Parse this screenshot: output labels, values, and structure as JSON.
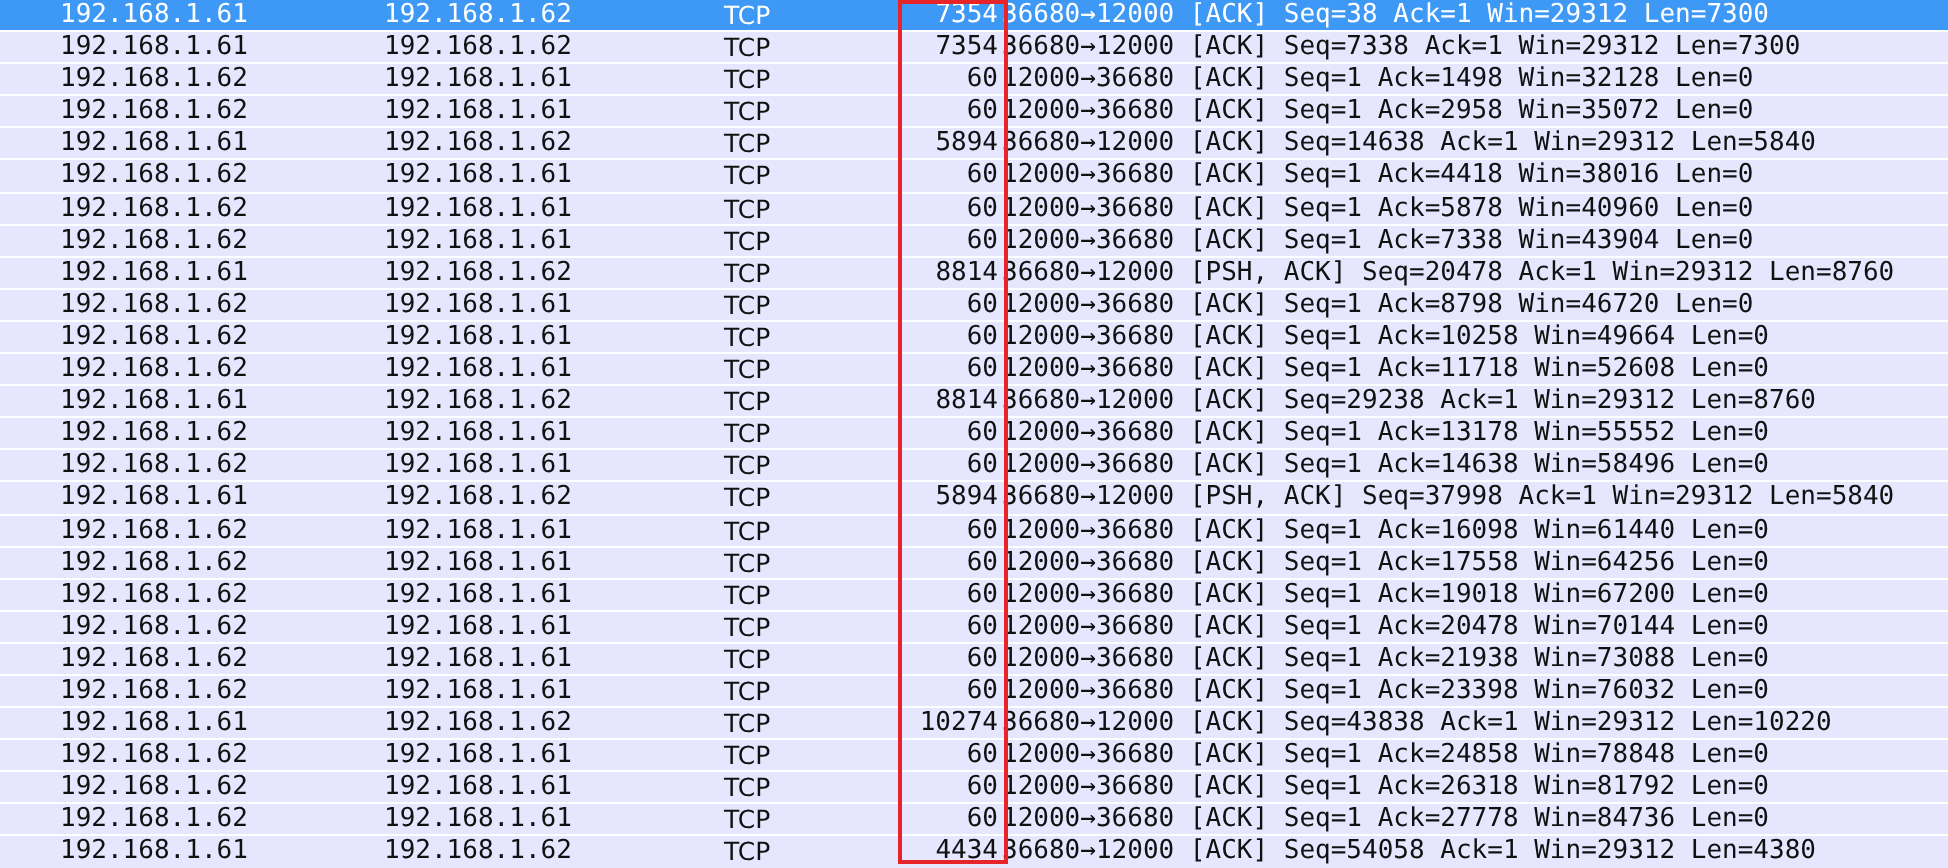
{
  "packets": [
    {
      "source": "192.168.1.61",
      "destination": "192.168.1.62",
      "protocol": "TCP",
      "length": "7354",
      "info": "36680→12000 [ACK] Seq=38 Ack=1 Win=29312 Len=7300",
      "selected": true
    },
    {
      "source": "192.168.1.61",
      "destination": "192.168.1.62",
      "protocol": "TCP",
      "length": "7354",
      "info": "36680→12000 [ACK] Seq=7338 Ack=1 Win=29312 Len=7300",
      "selected": false
    },
    {
      "source": "192.168.1.62",
      "destination": "192.168.1.61",
      "protocol": "TCP",
      "length": "60",
      "info": "12000→36680 [ACK] Seq=1 Ack=1498 Win=32128 Len=0",
      "selected": false
    },
    {
      "source": "192.168.1.62",
      "destination": "192.168.1.61",
      "protocol": "TCP",
      "length": "60",
      "info": "12000→36680 [ACK] Seq=1 Ack=2958 Win=35072 Len=0",
      "selected": false
    },
    {
      "source": "192.168.1.61",
      "destination": "192.168.1.62",
      "protocol": "TCP",
      "length": "5894",
      "info": "36680→12000 [ACK] Seq=14638 Ack=1 Win=29312 Len=5840",
      "selected": false
    },
    {
      "source": "192.168.1.62",
      "destination": "192.168.1.61",
      "protocol": "TCP",
      "length": "60",
      "info": "12000→36680 [ACK] Seq=1 Ack=4418 Win=38016 Len=0",
      "selected": false
    },
    {
      "source": "192.168.1.62",
      "destination": "192.168.1.61",
      "protocol": "TCP",
      "length": "60",
      "info": "12000→36680 [ACK] Seq=1 Ack=5878 Win=40960 Len=0",
      "selected": false
    },
    {
      "source": "192.168.1.62",
      "destination": "192.168.1.61",
      "protocol": "TCP",
      "length": "60",
      "info": "12000→36680 [ACK] Seq=1 Ack=7338 Win=43904 Len=0",
      "selected": false
    },
    {
      "source": "192.168.1.61",
      "destination": "192.168.1.62",
      "protocol": "TCP",
      "length": "8814",
      "info": "36680→12000 [PSH, ACK] Seq=20478 Ack=1 Win=29312 Len=8760",
      "selected": false
    },
    {
      "source": "192.168.1.62",
      "destination": "192.168.1.61",
      "protocol": "TCP",
      "length": "60",
      "info": "12000→36680 [ACK] Seq=1 Ack=8798 Win=46720 Len=0",
      "selected": false
    },
    {
      "source": "192.168.1.62",
      "destination": "192.168.1.61",
      "protocol": "TCP",
      "length": "60",
      "info": "12000→36680 [ACK] Seq=1 Ack=10258 Win=49664 Len=0",
      "selected": false
    },
    {
      "source": "192.168.1.62",
      "destination": "192.168.1.61",
      "protocol": "TCP",
      "length": "60",
      "info": "12000→36680 [ACK] Seq=1 Ack=11718 Win=52608 Len=0",
      "selected": false
    },
    {
      "source": "192.168.1.61",
      "destination": "192.168.1.62",
      "protocol": "TCP",
      "length": "8814",
      "info": "36680→12000 [ACK] Seq=29238 Ack=1 Win=29312 Len=8760",
      "selected": false
    },
    {
      "source": "192.168.1.62",
      "destination": "192.168.1.61",
      "protocol": "TCP",
      "length": "60",
      "info": "12000→36680 [ACK] Seq=1 Ack=13178 Win=55552 Len=0",
      "selected": false
    },
    {
      "source": "192.168.1.62",
      "destination": "192.168.1.61",
      "protocol": "TCP",
      "length": "60",
      "info": "12000→36680 [ACK] Seq=1 Ack=14638 Win=58496 Len=0",
      "selected": false
    },
    {
      "source": "192.168.1.61",
      "destination": "192.168.1.62",
      "protocol": "TCP",
      "length": "5894",
      "info": "36680→12000 [PSH, ACK] Seq=37998 Ack=1 Win=29312 Len=5840",
      "selected": false
    },
    {
      "source": "192.168.1.62",
      "destination": "192.168.1.61",
      "protocol": "TCP",
      "length": "60",
      "info": "12000→36680 [ACK] Seq=1 Ack=16098 Win=61440 Len=0",
      "selected": false
    },
    {
      "source": "192.168.1.62",
      "destination": "192.168.1.61",
      "protocol": "TCP",
      "length": "60",
      "info": "12000→36680 [ACK] Seq=1 Ack=17558 Win=64256 Len=0",
      "selected": false
    },
    {
      "source": "192.168.1.62",
      "destination": "192.168.1.61",
      "protocol": "TCP",
      "length": "60",
      "info": "12000→36680 [ACK] Seq=1 Ack=19018 Win=67200 Len=0",
      "selected": false
    },
    {
      "source": "192.168.1.62",
      "destination": "192.168.1.61",
      "protocol": "TCP",
      "length": "60",
      "info": "12000→36680 [ACK] Seq=1 Ack=20478 Win=70144 Len=0",
      "selected": false
    },
    {
      "source": "192.168.1.62",
      "destination": "192.168.1.61",
      "protocol": "TCP",
      "length": "60",
      "info": "12000→36680 [ACK] Seq=1 Ack=21938 Win=73088 Len=0",
      "selected": false
    },
    {
      "source": "192.168.1.62",
      "destination": "192.168.1.61",
      "protocol": "TCP",
      "length": "60",
      "info": "12000→36680 [ACK] Seq=1 Ack=23398 Win=76032 Len=0",
      "selected": false
    },
    {
      "source": "192.168.1.61",
      "destination": "192.168.1.62",
      "protocol": "TCP",
      "length": "10274",
      "info": "36680→12000 [ACK] Seq=43838 Ack=1 Win=29312 Len=10220",
      "selected": false
    },
    {
      "source": "192.168.1.62",
      "destination": "192.168.1.61",
      "protocol": "TCP",
      "length": "60",
      "info": "12000→36680 [ACK] Seq=1 Ack=24858 Win=78848 Len=0",
      "selected": false
    },
    {
      "source": "192.168.1.62",
      "destination": "192.168.1.61",
      "protocol": "TCP",
      "length": "60",
      "info": "12000→36680 [ACK] Seq=1 Ack=26318 Win=81792 Len=0",
      "selected": false
    },
    {
      "source": "192.168.1.62",
      "destination": "192.168.1.61",
      "protocol": "TCP",
      "length": "60",
      "info": "12000→36680 [ACK] Seq=1 Ack=27778 Win=84736 Len=0",
      "selected": false
    },
    {
      "source": "192.168.1.61",
      "destination": "192.168.1.62",
      "protocol": "TCP",
      "length": "4434",
      "info": "36680→12000 [ACK] Seq=54058 Ack=1 Win=29312 Len=4380",
      "selected": false
    }
  ]
}
